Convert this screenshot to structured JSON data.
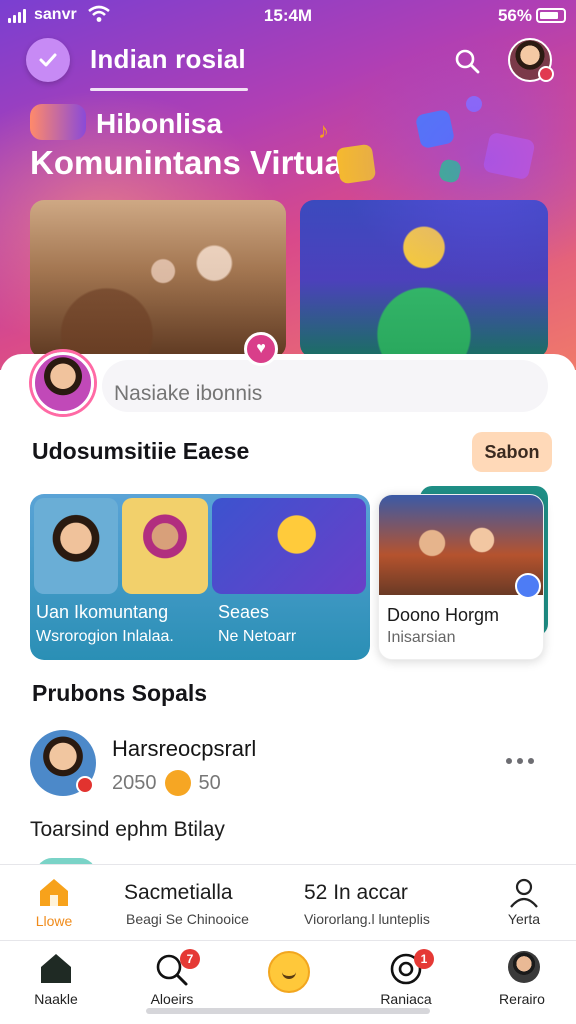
{
  "status_bar": {
    "carrier": "sanvr",
    "time": "15:4M",
    "battery": "56%"
  },
  "header": {
    "app_title": "Indian rosial"
  },
  "hero": {
    "subtitle": "Hibonlisa",
    "title": "Komunintans Virtual"
  },
  "composer": {
    "placeholder": "Nasiake ibonnis"
  },
  "communities": {
    "title": "Udosumsitiie Eaese",
    "cta": "Sabon",
    "card1": {
      "label_a": "Uan Ikomuntang",
      "label_b": "Wsrorogion Inlalaa.",
      "label_c": "Seaes",
      "label_d": "Ne Netoarr"
    },
    "card2": {
      "name": "Doono Horgm",
      "sub": "Inisarsian"
    }
  },
  "posts": {
    "title": "Prubons Sopals",
    "item": {
      "name": "Harsreocpsrarl",
      "meta_a": "2050",
      "meta_b": "50",
      "text": "Toarsind ephm Btilay"
    }
  },
  "subnav": {
    "home_label": "Llowe",
    "mid1_big": "Sacmetialla",
    "mid1_small": "Beagi Se Chinooice",
    "mid2_big": "52 In accar",
    "mid2_small": "Viororlang.l lunteplis",
    "profile_label": "Yerta"
  },
  "bottom_nav": [
    {
      "label": "Naakle"
    },
    {
      "label": "Aloeirs",
      "badge": "7"
    },
    {
      "label": ""
    },
    {
      "label": "Raniaca",
      "badge": "1"
    },
    {
      "label": "Rerairo"
    }
  ],
  "colors": {
    "accent_orange": "#f08b1a",
    "hero_purple": "#7a3fd1",
    "hero_pink": "#d94a8a",
    "badge_red": "#e53935"
  }
}
